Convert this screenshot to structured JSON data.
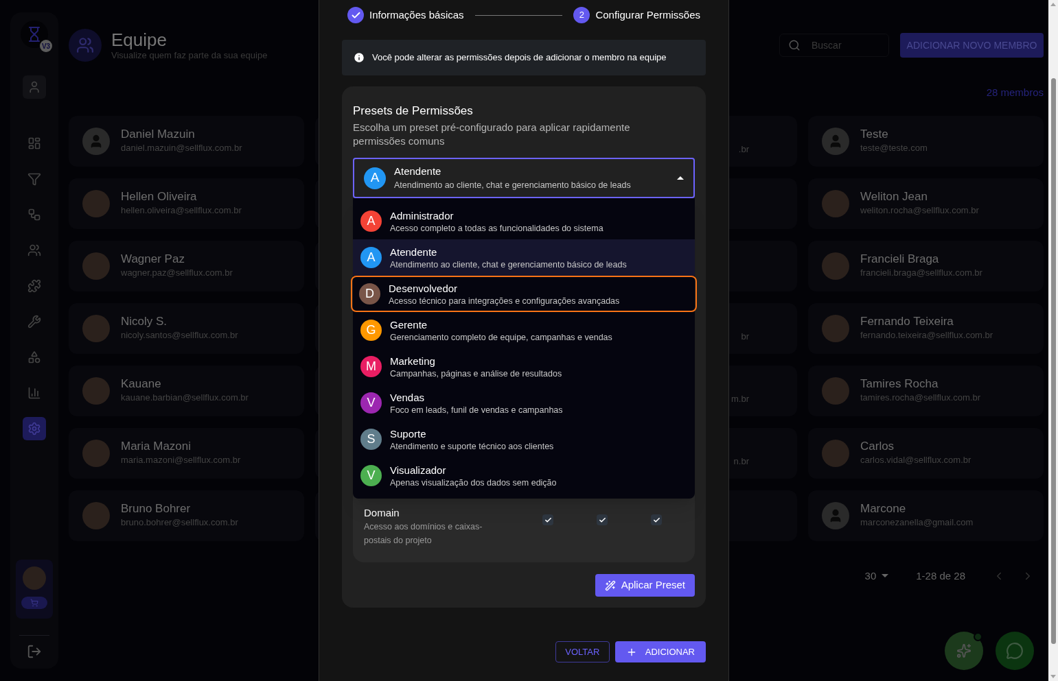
{
  "sidebar": {
    "logo_badge": "V3",
    "nav": [
      {
        "kind": "user",
        "selected": false
      },
      {
        "kind": "dashboard",
        "selected": false
      },
      {
        "kind": "filter",
        "selected": false
      },
      {
        "kind": "flow",
        "selected": false
      },
      {
        "kind": "team",
        "selected": false
      },
      {
        "kind": "puzzle",
        "selected": false
      },
      {
        "kind": "wrench",
        "selected": false
      },
      {
        "kind": "widgets",
        "selected": false
      },
      {
        "kind": "chart",
        "selected": false
      },
      {
        "kind": "settings",
        "selected": true
      }
    ]
  },
  "header": {
    "title": "Equipe",
    "subtitle": "Visualize quem faz parte da sua equipe",
    "search": {
      "placeholder": "Buscar"
    },
    "add_button": "ADICIONAR NOVO MEMBRO",
    "count": "28 membros"
  },
  "members_left": [
    {
      "name": "Daniel Mazuin",
      "email": "daniel.mazuin@sellflux.com.br",
      "kind": "default"
    },
    {
      "name": "Hellen Oliveira",
      "email": "hellen.oliveira@sellflux.com.br",
      "kind": "photo"
    },
    {
      "name": "Wagner Paz",
      "email": "wagner.paz@sellflux.com.br",
      "kind": "photo"
    },
    {
      "name": "Nicoly S.",
      "email": "nicoly.santos@sellflux.com.br",
      "kind": "photo"
    },
    {
      "name": "Kauane",
      "email": "kauane.barbian@sellflux.com.br",
      "kind": "photo"
    },
    {
      "name": "Maria Mazoni",
      "email": "maria.mazoni@sellflux.com.br",
      "kind": "photo"
    },
    {
      "name": "Bruno Bohrer",
      "email": "bruno.bohrer@sellflux.com.br",
      "kind": "photo"
    }
  ],
  "members_partial": [
    {
      "kind": "fragment",
      "email": ".br"
    },
    {
      "kind": "covered"
    },
    {
      "kind": "covered"
    },
    {
      "kind": "fragment",
      "email": "br"
    },
    {
      "kind": "fragment",
      "email": "m.br"
    },
    {
      "kind": "fragment",
      "email": "n.br"
    },
    {
      "kind": "covered"
    }
  ],
  "members_right": [
    {
      "name": "Teste",
      "email": "teste@teste.com",
      "kind": "default"
    },
    {
      "name": "Weliton Jean",
      "email": "weliton.rocha@sellflux.com.br",
      "kind": "photo"
    },
    {
      "name": "Francieli Braga",
      "email": "francieli.braga@sellflux.com.br",
      "kind": "photo"
    },
    {
      "name": "Fernando Teixeira",
      "email": "fernando.teixeira@sellflux.com.br",
      "kind": "photo"
    },
    {
      "name": "Tamires Rocha",
      "email": "tamires.rocha@sellflux.com.br",
      "kind": "photo"
    },
    {
      "name": "Carlos",
      "email": "carlos.vidal@sellflux.com.br",
      "kind": "photo"
    },
    {
      "name": "Marcone",
      "email": "marconezanella@gmail.com",
      "kind": "default"
    }
  ],
  "pagination": {
    "per_page": "30",
    "range": "1-28 de 28"
  },
  "modal": {
    "steps": [
      {
        "label": "Informações básicas",
        "done": true
      },
      {
        "label": "Configurar Permissões",
        "done": false,
        "number": "2"
      }
    ],
    "info": "Você pode alterar as permissões depois de adicionar o membro na equipe",
    "presets": {
      "title": "Presets de Permissões",
      "description": "Escolha um preset pré-configurado para aplicar rapidamente permissões comuns",
      "select": {
        "letter": "A",
        "name": "Atendente",
        "description": "Atendimento ao cliente, chat e gerenciamento básico de leads",
        "color": "#2196f3",
        "expanded": true
      },
      "options": [
        {
          "letter": "A",
          "name": "Administrador",
          "description": "Acesso completo a todas as funcionalidades do sistema",
          "color": "#f44336",
          "selected": false,
          "focused": false
        },
        {
          "letter": "A",
          "name": "Atendente",
          "description": "Atendimento ao cliente, chat e gerenciamento básico de leads",
          "color": "#2196f3",
          "selected": true,
          "focused": false
        },
        {
          "letter": "D",
          "name": "Desenvolvedor",
          "description": "Acesso técnico para integrações e configurações avançadas",
          "color": "#795548",
          "selected": false,
          "focused": true
        },
        {
          "letter": "G",
          "name": "Gerente",
          "description": "Gerenciamento completo de equipe, campanhas e vendas",
          "color": "#ff9800",
          "selected": false,
          "focused": false
        },
        {
          "letter": "M",
          "name": "Marketing",
          "description": "Campanhas, páginas e análise de resultados",
          "color": "#e91e63",
          "selected": false,
          "focused": false
        },
        {
          "letter": "V",
          "name": "Vendas",
          "description": "Foco em leads, funil de vendas e campanhas",
          "color": "#9c27b0",
          "selected": false,
          "focused": false
        },
        {
          "letter": "S",
          "name": "Suporte",
          "description": "Atendimento e suporte técnico aos clientes",
          "color": "#607d8b",
          "selected": false,
          "focused": false
        },
        {
          "letter": "V",
          "name": "Visualizador",
          "description": "Apenas visualização dos dados sem edição",
          "color": "#4caf50",
          "selected": false,
          "focused": false
        }
      ],
      "permission_row": {
        "name": "Domain",
        "description": "Acesso aos domínios e caixas-postais do projeto",
        "checks": [
          true,
          true,
          true
        ]
      },
      "apply_button": "Aplicar Preset"
    },
    "back_button": "VOLTAR",
    "add_button": "ADICIONAR"
  }
}
